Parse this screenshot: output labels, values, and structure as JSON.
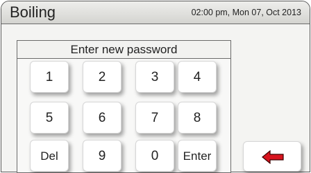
{
  "header": {
    "title": "Boiling",
    "datetime": "02:00 pm, Mon 07, Oct 2013"
  },
  "password_panel": {
    "heading": "Enter new password",
    "keys": {
      "k1": "1",
      "k2": "2",
      "k3": "3",
      "k4": "4",
      "k5": "5",
      "k6": "6",
      "k7": "7",
      "k8": "8",
      "del": "Del",
      "k9": "9",
      "k0": "0",
      "enter": "Enter"
    }
  },
  "back_button": {
    "icon": "left-arrow-icon",
    "icon_color": "#d8141e"
  }
}
